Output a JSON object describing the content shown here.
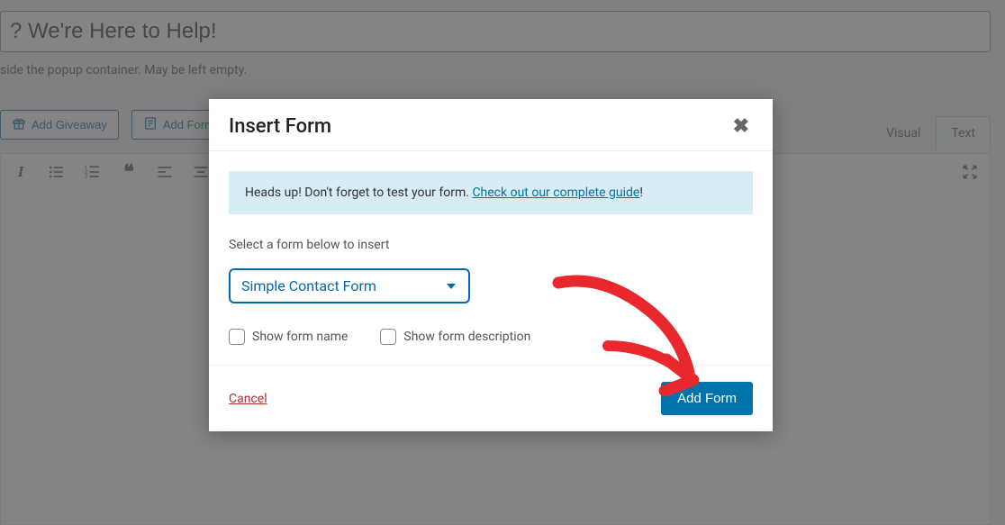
{
  "background": {
    "title_value": "? We're Here to Help!",
    "help_text": "side the popup container. May be left empty.",
    "toolbar_buttons": {
      "add_giveaway": "Add Giveaway",
      "add_form": "Add Form"
    },
    "editor_tabs": {
      "visual": "Visual",
      "text": "Text"
    }
  },
  "modal": {
    "title": "Insert Form",
    "banner_text": "Heads up! Don't forget to test your form. ",
    "banner_link": "Check out our complete guide",
    "banner_exclaim": "!",
    "select_label": "Select a form below to insert",
    "selected_form": "Simple Contact Form",
    "checkbox_name": "Show form name",
    "checkbox_desc": "Show form description",
    "cancel": "Cancel",
    "add_form": "Add Form"
  }
}
